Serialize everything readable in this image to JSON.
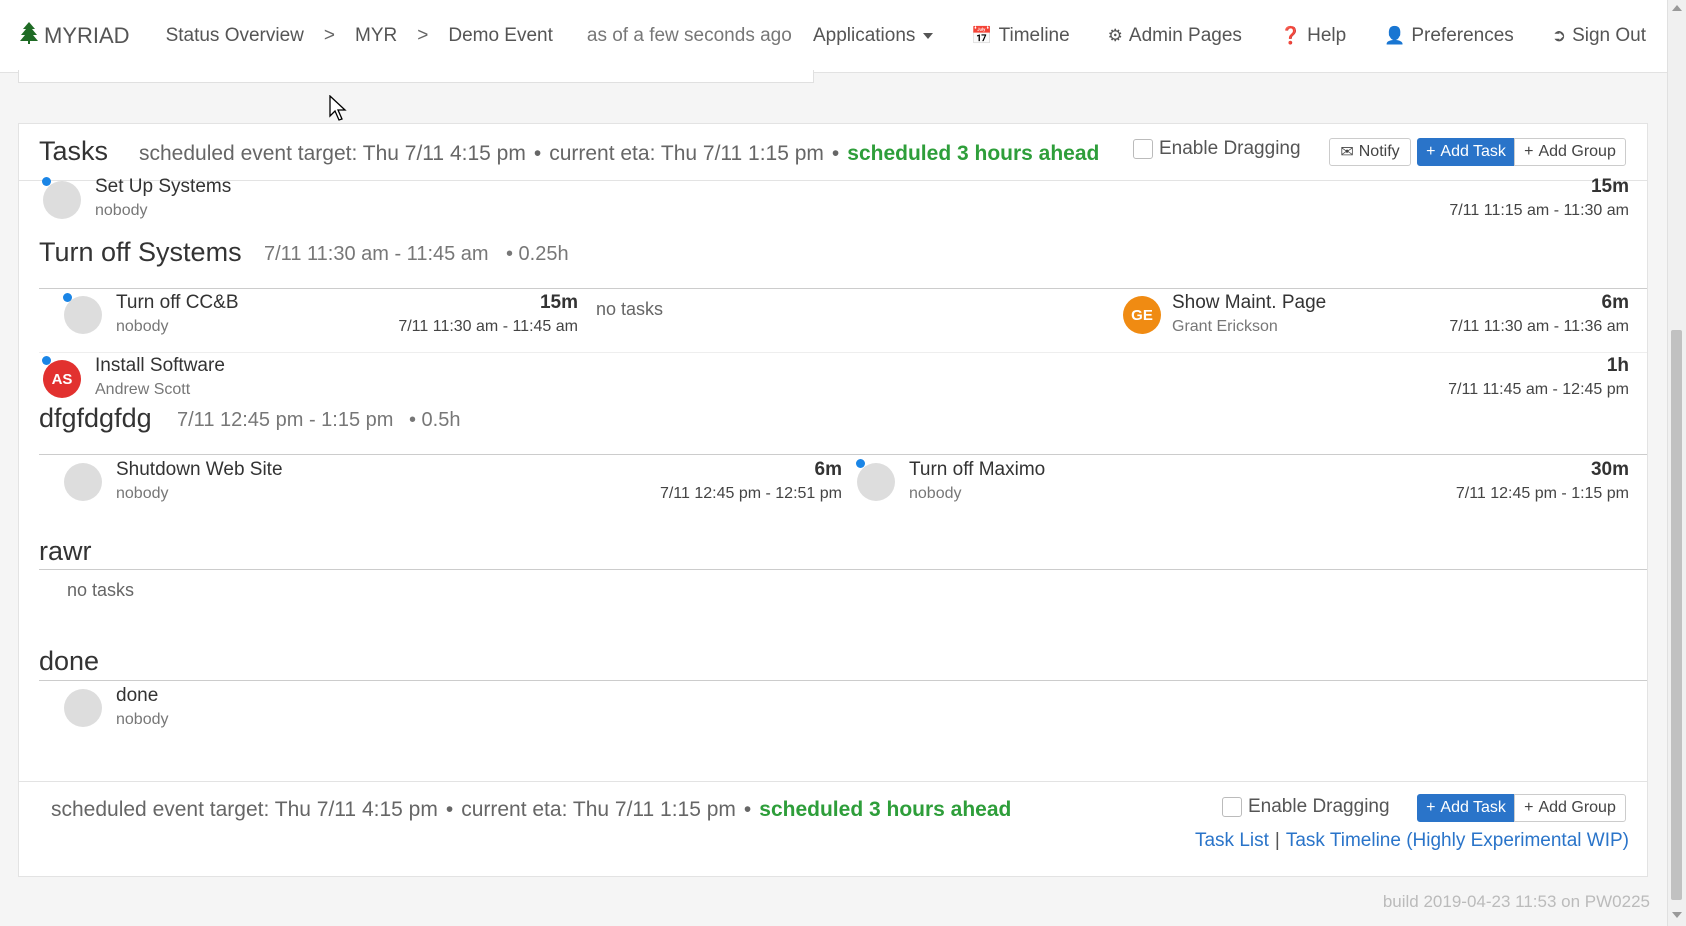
{
  "nav": {
    "brand": "MYRIAD",
    "crumbs": [
      "Status Overview",
      ">",
      "MYR",
      ">",
      "Demo Event"
    ],
    "as_of": "as of a few seconds ago",
    "applications": "Applications",
    "timeline": "Timeline",
    "admin": "Admin Pages",
    "help": "Help",
    "preferences": "Preferences",
    "signout": "Sign Out"
  },
  "tasks_panel": {
    "title": "Tasks",
    "target": "scheduled event target: Thu 7/11 4:15 pm",
    "eta": "current eta: Thu 7/11 1:15 pm",
    "ahead": "scheduled 3 hours ahead",
    "bullet": "•",
    "enable_dragging": "Enable Dragging",
    "notify": "Notify",
    "add_task": "Add Task",
    "add_group": "Add Group"
  },
  "tasks": {
    "setup": {
      "name": "Set Up Systems",
      "owner": "nobody",
      "dur": "15m",
      "time": "7/11 11:15 am - 11:30 am"
    },
    "install": {
      "name": "Install Software",
      "owner": "Andrew Scott",
      "initials": "AS",
      "dur": "1h",
      "time": "7/11 11:45 am - 12:45 pm"
    }
  },
  "groups": {
    "turnoff": {
      "title": "Turn off Systems",
      "meta": "7/11 11:30 am - 11:45 am",
      "dur": "• 0.25h",
      "task1": {
        "name": "Turn off CC&B",
        "owner": "nobody",
        "dur": "15m",
        "time": "7/11 11:30 am - 11:45 am"
      },
      "notasks": "no tasks",
      "task2": {
        "name": "Show Maint. Page",
        "owner": "Grant Erickson",
        "initials": "GE",
        "dur": "6m",
        "time": "7/11 11:30 am - 11:36 am"
      }
    },
    "dfg": {
      "title": "dfgfdgfdg",
      "meta": "7/11 12:45 pm - 1:15 pm",
      "dur": "• 0.5h",
      "task1": {
        "name": "Shutdown Web Site",
        "owner": "nobody",
        "dur": "6m",
        "time": "7/11 12:45 pm - 12:51 pm"
      },
      "task2": {
        "name": "Turn off Maximo",
        "owner": "nobody",
        "dur": "30m",
        "time": "7/11 12:45 pm - 1:15 pm"
      }
    },
    "rawr": {
      "title": "rawr",
      "notasks": "no tasks"
    },
    "done": {
      "title": "done",
      "task1": {
        "name": "done",
        "owner": "nobody"
      }
    }
  },
  "footer": {
    "target": "scheduled event target: Thu 7/11 4:15 pm",
    "eta": "current eta: Thu 7/11 1:15 pm",
    "ahead": "scheduled 3 hours ahead",
    "enable_dragging": "Enable Dragging",
    "add_task": "Add Task",
    "add_group": "Add Group",
    "task_list": "Task List",
    "bar": "|",
    "task_timeline": "Task Timeline (Highly Experimental WIP)"
  },
  "build": "build 2019-04-23 11:53 on PW0225",
  "colors": {
    "accent": "#2a74c9",
    "ahead": "#2e9e3a",
    "status_dot": "#1a85e6",
    "avatar_as": "#e2312f",
    "avatar_ge": "#f08b12"
  }
}
